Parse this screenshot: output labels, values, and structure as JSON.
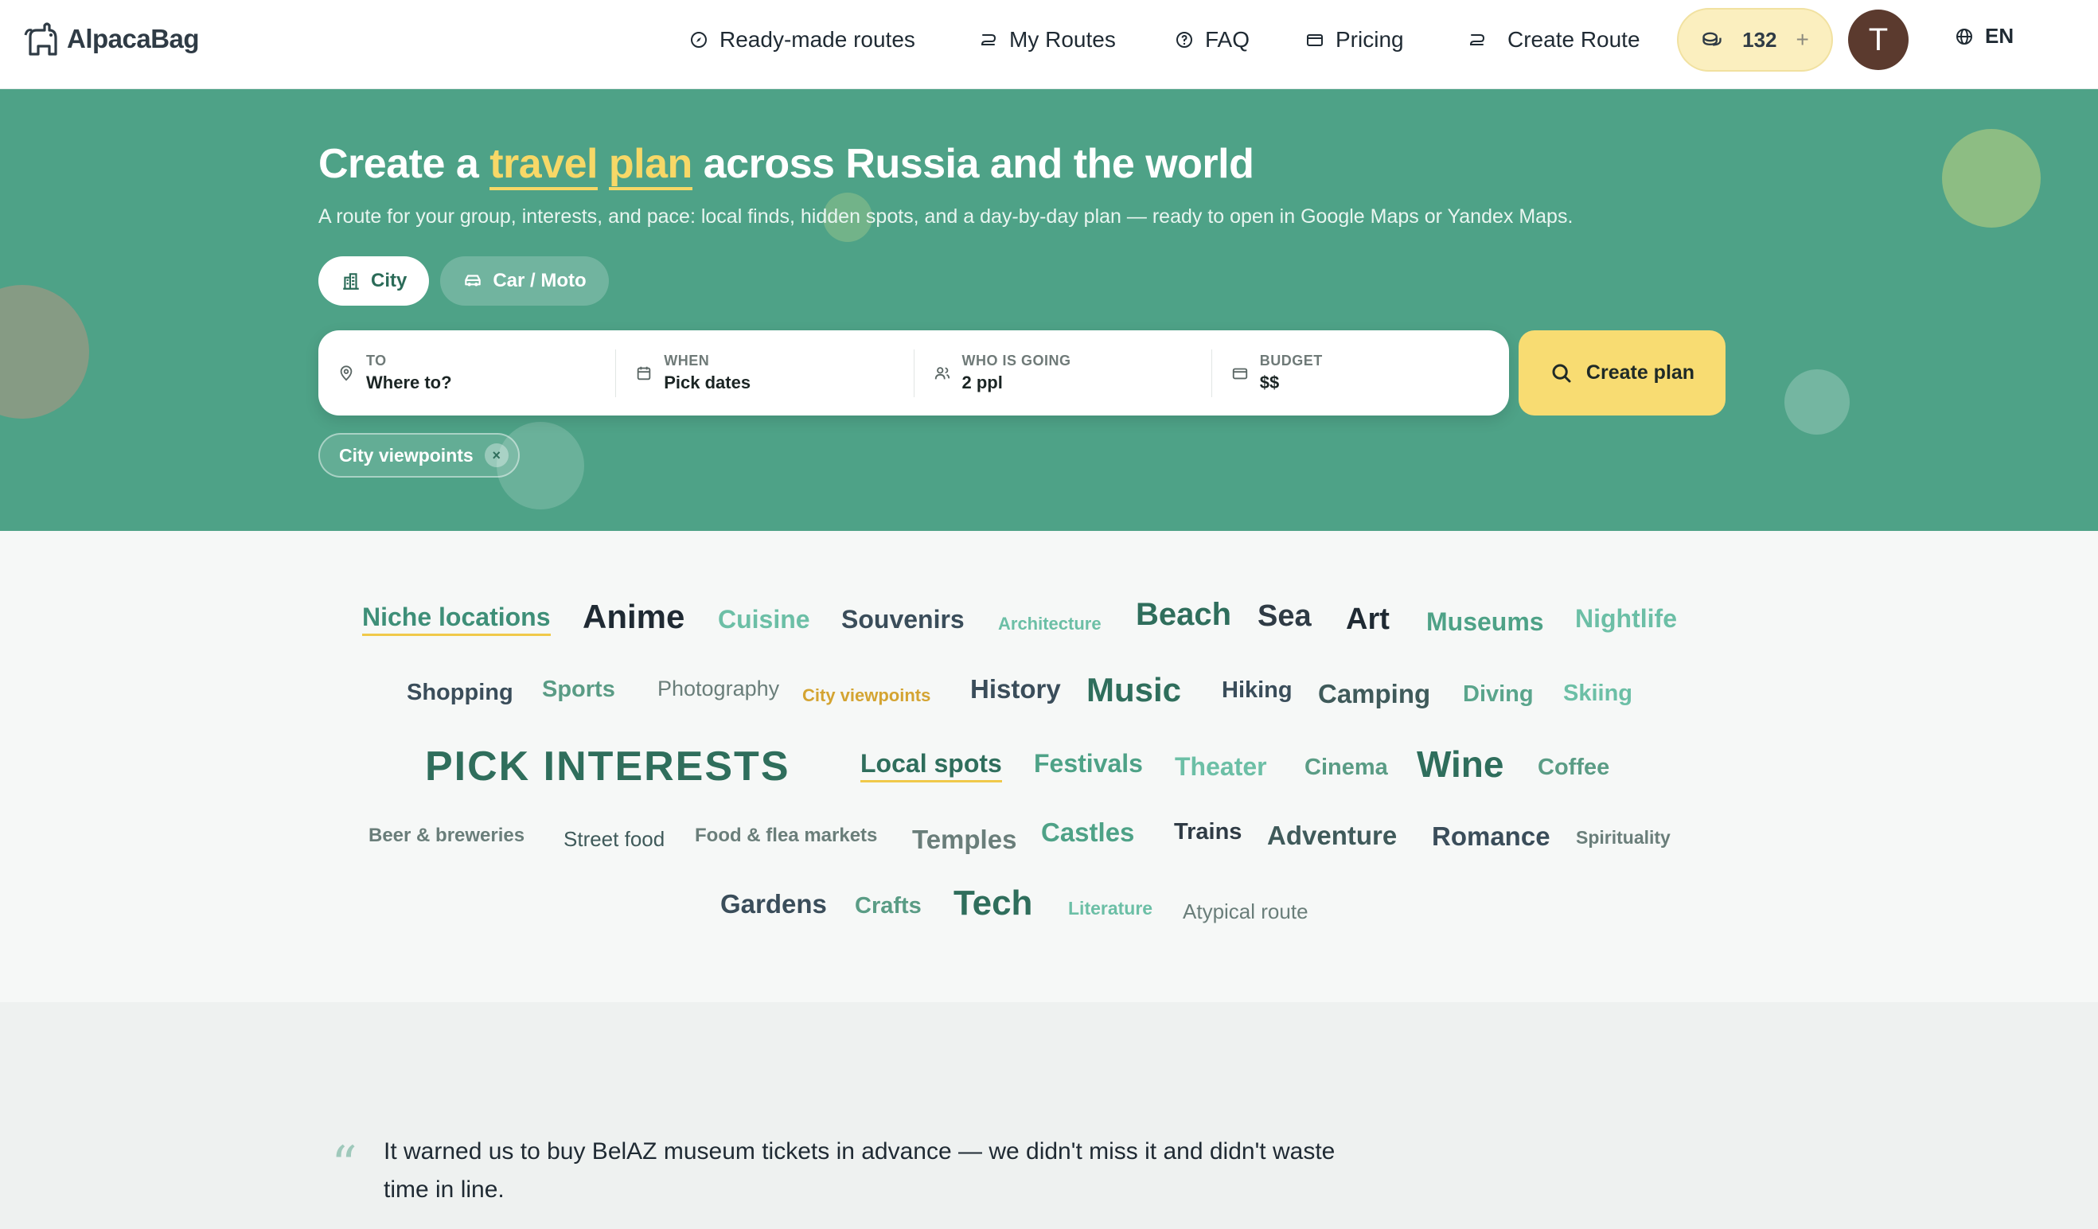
{
  "header": {
    "logo": "AlpacaBag",
    "nav": [
      {
        "label": "Ready-made routes",
        "icon": "compass-icon"
      },
      {
        "label": "My Routes",
        "icon": "route-icon"
      },
      {
        "label": "FAQ",
        "icon": "help-circle-icon"
      },
      {
        "label": "Pricing",
        "icon": "wallet-icon"
      },
      {
        "label": "Create Route",
        "icon": "route-plus-icon"
      }
    ],
    "credits": "132",
    "credits_plus": "+",
    "avatar_initial": "T",
    "language": "EN"
  },
  "hero": {
    "title_pre": "Create a",
    "title_hl_1": "travel",
    "title_hl_2": "plan",
    "title_post": "across Russia and the world",
    "subtitle": "A route for your group, interests, and pace: local finds, hidden spots, and a day-by-day plan — ready to open in Google Maps or Yandex Maps.",
    "modes": [
      {
        "label": "City",
        "active": true
      },
      {
        "label": "Car / Moto",
        "active": false
      }
    ],
    "search": {
      "to": {
        "label": "TO",
        "value": "Where to?"
      },
      "when": {
        "label": "WHEN",
        "value": "Pick dates"
      },
      "who": {
        "label": "WHO IS GOING",
        "value": "2 ppl"
      },
      "budget": {
        "label": "BUDGET",
        "value": "$$"
      }
    },
    "create_button": "Create plan",
    "selected_chip": "City viewpoints",
    "chip_remove": "×"
  },
  "tags": {
    "heading": "PICK INTERESTS",
    "items": [
      "Niche locations",
      "Anime",
      "Cuisine",
      "Souvenirs",
      "Architecture",
      "Beach",
      "Sea",
      "Art",
      "Museums",
      "Nightlife",
      "Shopping",
      "Sports",
      "Photography",
      "City viewpoints",
      "History",
      "Music",
      "Hiking",
      "Camping",
      "Diving",
      "Skiing",
      "Local spots",
      "Festivals",
      "Theater",
      "Cinema",
      "Wine",
      "Coffee",
      "Beer & breweries",
      "Street food",
      "Food & flea markets",
      "Temples",
      "Castles",
      "Trains",
      "Adventure",
      "Romance",
      "Spirituality",
      "Gardens",
      "Crafts",
      "Tech",
      "Literature",
      "Atypical route"
    ]
  },
  "testimonial": {
    "quote_mark": "“",
    "text": "It warned us to buy BelAZ museum tickets in advance — we didn't miss it and didn't waste time in line."
  },
  "colors": {
    "brand_green": "#4ea287",
    "accent_yellow": "#f8dc72",
    "highlight_yellow": "#f7d867",
    "avatar_brown": "#5b3a2e"
  }
}
